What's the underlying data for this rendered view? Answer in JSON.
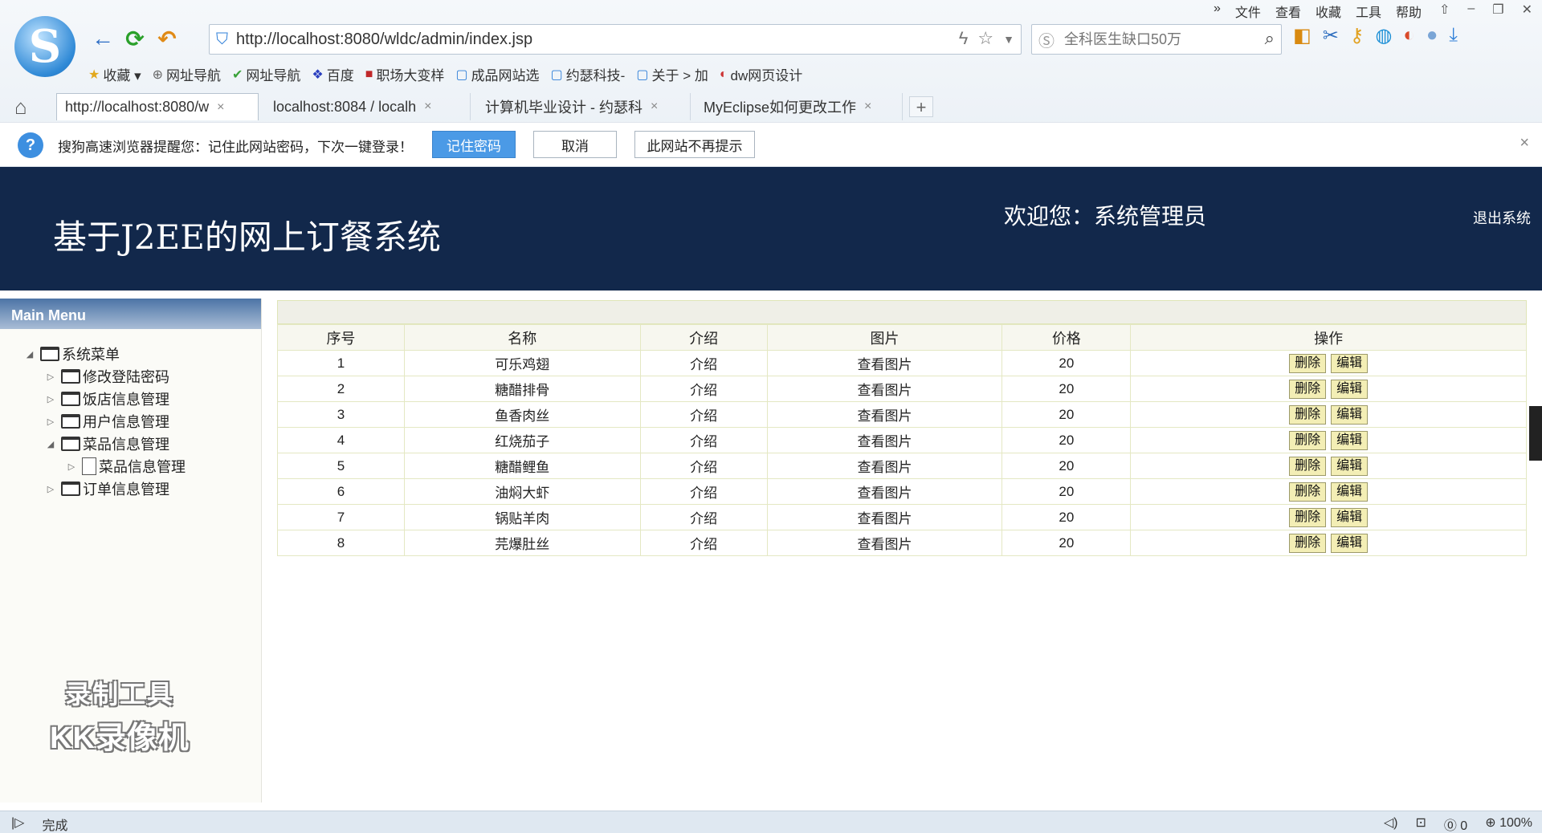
{
  "browser": {
    "top_menu": [
      "»",
      "文件",
      "查看",
      "收藏",
      "工具",
      "帮助"
    ],
    "window_controls": [
      "⇧",
      "–",
      "❐",
      "✕"
    ],
    "logo_letter": "S",
    "url": "http://localhost:8080/wldc/admin/index.jsp",
    "search_placeholder": "全科医生缺口50万",
    "bookmarks": [
      {
        "icon": "★",
        "label": "收藏 ▾"
      },
      {
        "icon": "⊕",
        "label": "网址导航"
      },
      {
        "icon": "✔",
        "label": "网址导航"
      },
      {
        "icon": "❖",
        "label": "百度"
      },
      {
        "icon": "■",
        "label": "职场大变样"
      },
      {
        "icon": "▢",
        "label": "成品网站选"
      },
      {
        "icon": "▢",
        "label": "约瑟科技-"
      },
      {
        "icon": "▢",
        "label": "关于 > 加"
      },
      {
        "icon": "◐",
        "label": "dw网页设计"
      }
    ],
    "tabs": [
      {
        "label": "http://localhost:8080/w",
        "close": "×"
      },
      {
        "label": "localhost:8084 / localh",
        "close": "×"
      },
      {
        "label": "计算机毕业设计 - 约瑟科",
        "close": "×"
      },
      {
        "label": "MyEclipse如何更改工作",
        "close": "×"
      }
    ],
    "new_tab": "+",
    "infobar": {
      "icon": "?",
      "message": "搜狗高速浏览器提醒您：记住此网站密码，下次一键登录！",
      "remember": "记住密码",
      "cancel": "取消",
      "never": "此网站不再提示",
      "close": "×"
    },
    "status": {
      "left_icon": "|▷",
      "text": "完成",
      "right": [
        "◁)",
        "⊡",
        "⓪ 0",
        "⊕ 100%"
      ]
    }
  },
  "app": {
    "title": "基于J2EE的网上订餐系统",
    "welcome": "欢迎您：系统管理员",
    "logout": "退出系统"
  },
  "sidebar": {
    "header": "Main Menu",
    "tree": {
      "root": "系统菜单",
      "items": [
        "修改登陆密码",
        "饭店信息管理",
        "用户信息管理",
        "菜品信息管理",
        "订单信息管理"
      ],
      "child": "菜品信息管理"
    },
    "toggle_collapsed": "▷",
    "toggle_expanded": "◢"
  },
  "watermark": {
    "line1": "录制工具",
    "line2": "KK录像机"
  },
  "table": {
    "headers": [
      "序号",
      "名称",
      "介绍",
      "图片",
      "价格",
      "操作"
    ],
    "delete_label": "删除",
    "edit_label": "编辑",
    "rows": [
      {
        "id": "1",
        "name": "可乐鸡翅",
        "intro": "介绍",
        "img": "查看图片",
        "price": "20"
      },
      {
        "id": "2",
        "name": "糖醋排骨",
        "intro": "介绍",
        "img": "查看图片",
        "price": "20"
      },
      {
        "id": "3",
        "name": "鱼香肉丝",
        "intro": "介绍",
        "img": "查看图片",
        "price": "20"
      },
      {
        "id": "4",
        "name": "红烧茄子",
        "intro": "介绍",
        "img": "查看图片",
        "price": "20"
      },
      {
        "id": "5",
        "name": "糖醋鲤鱼",
        "intro": "介绍",
        "img": "查看图片",
        "price": "20"
      },
      {
        "id": "6",
        "name": "油焖大虾",
        "intro": "介绍",
        "img": "查看图片",
        "price": "20"
      },
      {
        "id": "7",
        "name": "锅贴羊肉",
        "intro": "介绍",
        "img": "查看图片",
        "price": "20"
      },
      {
        "id": "8",
        "name": "芫爆肚丝",
        "intro": "介绍",
        "img": "查看图片",
        "price": "20"
      }
    ]
  }
}
